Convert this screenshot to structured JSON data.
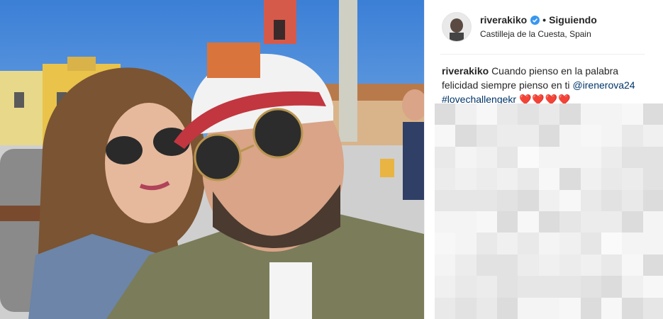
{
  "post": {
    "username": "riverakiko",
    "follow_label": "Siguiendo",
    "separator": "•",
    "location": "Castilleja de la Cuesta, Spain",
    "caption": {
      "username": "riverakiko",
      "text_part1": "Cuando pienso en la palabra felicidad siempre pienso en ti",
      "mention": "@irenerova24",
      "hashtag": "#lovechallengekr",
      "hearts": "❤️❤️❤️❤️"
    }
  },
  "icons": {
    "verified": "verified-badge-icon",
    "avatar": "profile-avatar"
  },
  "colors": {
    "link": "#003569",
    "verified": "#3897f0",
    "text": "#262626"
  }
}
